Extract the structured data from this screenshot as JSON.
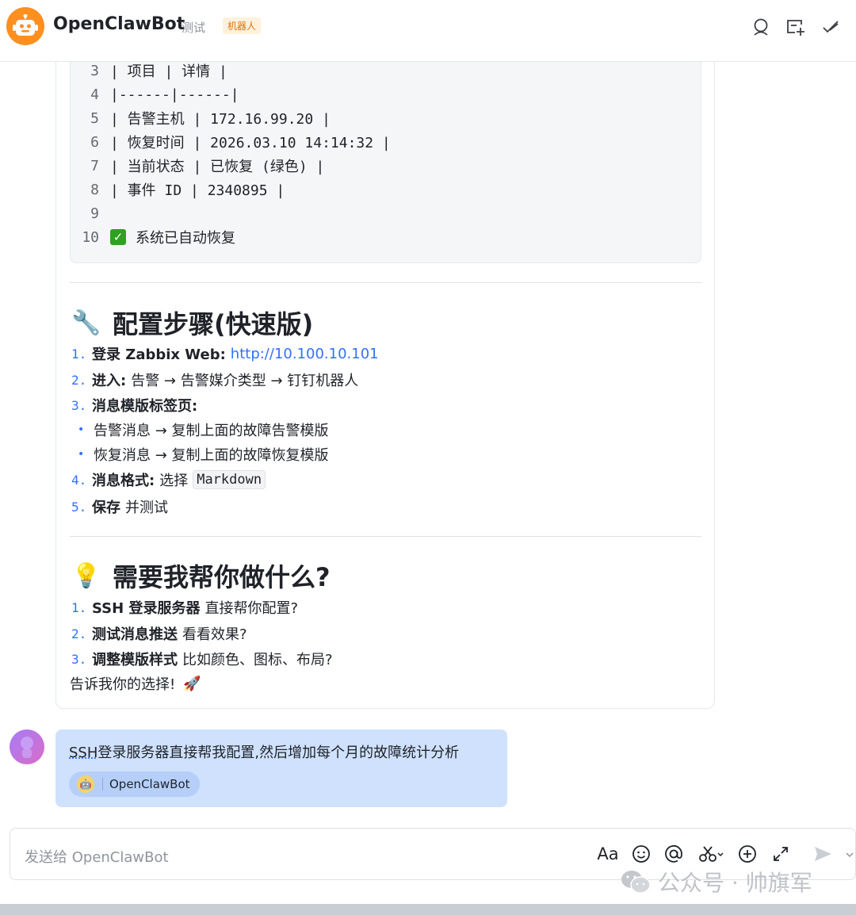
{
  "header": {
    "bot_name": "OpenClawBot",
    "tag_test": "测试",
    "tag_robot": "机器人",
    "icons": [
      "search-icon",
      "new-chat-icon",
      "done-icon"
    ]
  },
  "code_block": {
    "lines": [
      {
        "n": "3",
        "text": "| 项目 | 详情 |"
      },
      {
        "n": "4",
        "text": "|------|------|"
      },
      {
        "n": "5",
        "text": "| 告警主机 | 172.16.99.20 |"
      },
      {
        "n": "6",
        "text": "| 恢复时间 | 2026.03.10 14:14:32 |"
      },
      {
        "n": "7",
        "text": "| 当前状态 | 已恢复 (绿色) |"
      },
      {
        "n": "8",
        "text": "| 事件 ID | 2340895 |"
      },
      {
        "n": "9",
        "text": ""
      },
      {
        "n": "10",
        "text": "系统已自动恢复"
      }
    ]
  },
  "section1": {
    "emoji": "🔧",
    "title": "配置步骤(快速版)",
    "items": [
      {
        "num": "1.",
        "bold": "登录 Zabbix Web:",
        "link": "http://10.100.10.101"
      },
      {
        "num": "2.",
        "bold": "进入:",
        "text": "告警 → 告警媒介类型 → 钉钉机器人"
      },
      {
        "num": "3.",
        "bold": "消息模版标签页:"
      },
      {
        "bullet": "•",
        "text": "告警消息 → 复制上面的故障告警模版"
      },
      {
        "bullet": "•",
        "text": "恢复消息 → 复制上面的故障恢复模版"
      },
      {
        "num": "4.",
        "bold": "消息格式:",
        "text": "选择",
        "code": "Markdown"
      },
      {
        "num": "5.",
        "bold": "保存",
        "text": "并测试"
      }
    ]
  },
  "section2": {
    "emoji": "💡",
    "title": "需要我帮你做什么?",
    "items": [
      {
        "num": "1.",
        "bold": "SSH 登录服务器",
        "text": "直接帮你配置?"
      },
      {
        "num": "2.",
        "bold": "测试消息推送",
        "text": "看看效果?"
      },
      {
        "num": "3.",
        "bold": "调整模版样式",
        "text": "比如颜色、图标、布局?"
      }
    ],
    "closing": "告诉我你的选择!",
    "closing_emoji": "🚀"
  },
  "user_message": {
    "text_prefix": "SSH",
    "text_rest": "登录服务器直接帮我配置,然后增加每个月的故障统计分析",
    "mention": "OpenClawBot"
  },
  "composer": {
    "placeholder": "发送给 OpenClawBot",
    "tools": [
      "font-format-icon",
      "emoji-icon",
      "mention-icon",
      "scissors-icon",
      "add-icon",
      "expand-icon",
      "send-icon"
    ],
    "font_label": "Aa"
  },
  "watermark": {
    "text": "公众号 · 帅旗军"
  },
  "colors": {
    "accent": "#3370ff",
    "bot_orange": "#ff8f1f",
    "user_bubble": "#cfe1fd",
    "success_green": "#2ea121"
  }
}
